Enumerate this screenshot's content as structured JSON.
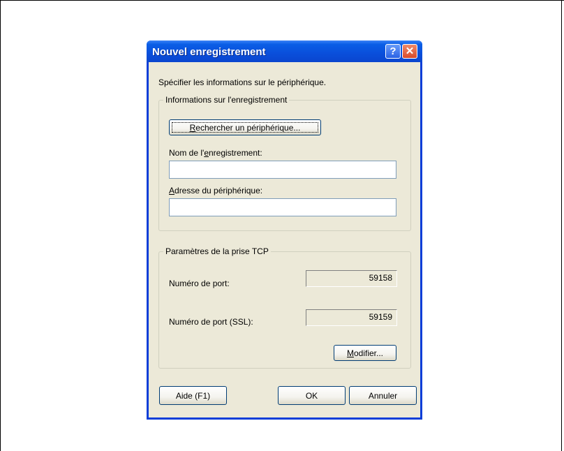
{
  "dialog": {
    "title": "Nouvel enregistrement",
    "help_glyph": "?",
    "close_glyph": "✕"
  },
  "instruction": "Spécifier les informations sur le périphérique.",
  "registration_group": {
    "title": "Informations sur l'enregistrement",
    "search_button": {
      "mnemonic": "R",
      "rest": "echercher un périphérique..."
    },
    "name_label": {
      "before": "Nom de l'",
      "mnemonic": "e",
      "after": "nregistrement:"
    },
    "name_value": "",
    "address_label": {
      "mnemonic": "A",
      "rest": "dresse du périphérique:"
    },
    "address_value": ""
  },
  "tcp_group": {
    "title": "Paramètres de la prise TCP",
    "port_label": "Numéro de port:",
    "port_value": "59158",
    "ssl_port_label": "Numéro de port (SSL):",
    "ssl_port_value": "59159",
    "modify_button": {
      "mnemonic": "M",
      "rest": "odifier..."
    }
  },
  "footer": {
    "help_button": "Aide (F1)",
    "ok_button": "OK",
    "cancel_button": "Annuler"
  },
  "icons": [
    "help-icon",
    "close-icon"
  ]
}
